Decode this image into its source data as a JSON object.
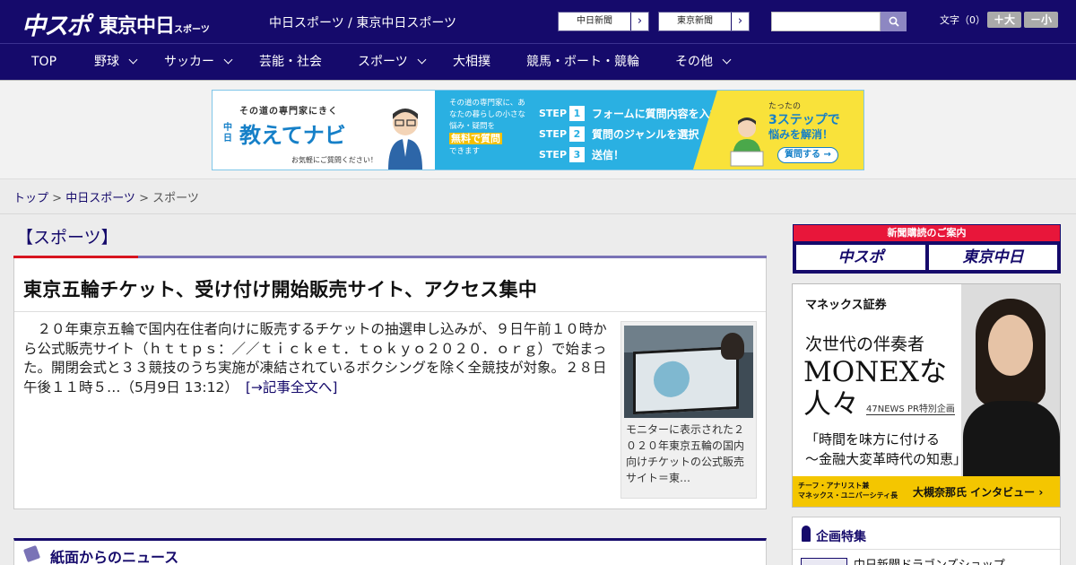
{
  "header": {
    "logo_chusupo": "中スポ",
    "logo_tokyo": "東京中日",
    "logo_tokyo_small": "スポーツ",
    "site_title": "中日スポーツ / 東京中日スポーツ",
    "paper_links": [
      "中日新聞",
      "東京新聞"
    ],
    "fontsize_label": "文字（0）",
    "fontsize_up": "＋大",
    "fontsize_down": "－小"
  },
  "nav": [
    {
      "label": "TOP"
    },
    {
      "label": "野球"
    },
    {
      "label": "サッカー"
    },
    {
      "label": "芸能・社会"
    },
    {
      "label": "スポーツ"
    },
    {
      "label": "大相撲"
    },
    {
      "label": "競馬・ボート・競輪"
    },
    {
      "label": "その他"
    }
  ],
  "banner": {
    "sub": "その道の専門家にきく",
    "chu": "中日",
    "main": "教えてナビ",
    "note": "お気軽にご質問ください！",
    "mid_text": "その道の専門家に、あなたの暮らしの小さな悩み・疑問を",
    "mid_highlight": "無料で質問",
    "mid_end": "できます",
    "steps": [
      {
        "label": "STEP",
        "num": "1",
        "text": "フォームに質問内容を入力"
      },
      {
        "label": "STEP",
        "num": "2",
        "text": "質問のジャンルを選択"
      },
      {
        "label": "STEP",
        "num": "3",
        "text": "送信！"
      }
    ],
    "r1": "たったの",
    "r2": "3ステップで",
    "r3": "悩みを解消！",
    "r4": "質問する →"
  },
  "breadcrumb": {
    "home": "トップ",
    "sep1": " > ",
    "section": "中日スポーツ",
    "sep2": " > ",
    "current": "スポーツ"
  },
  "section_heading": "【スポーツ】",
  "article": {
    "title": "東京五輪チケット、受け付け開始販売サイト、アクセス集中",
    "body": "　２０年東京五輪で国内在住者向けに販売するチケットの抽選申し込みが、９日午前１０時から公式販売サイト（ｈｔｔｐｓ：／／ｔｉｃｋｅｔ．ｔｏｋｙｏ２０２０．ｏｒｇ）で始まった。開閉会式と３３競技のうち実施が凍結されているボクシングを除く全競技が対象。２８日午後１１時５…（5月9日 13:12）",
    "more": "[→記事全文へ]",
    "caption": "モニターに表示された２０２０年東京五輪の国内向けチケットの公式販売サイト＝東…"
  },
  "news_section": "紙面からのニュース",
  "sidebar": {
    "subscribe_head": "新聞購読のご案内",
    "sub_logo1": "中スポ",
    "sub_logo2": "東京中日",
    "ad": {
      "brand": "マネックス証券",
      "line1": "次世代の伴奏者",
      "line2": "MONEXな人々",
      "tag": "47NEWS PR特別企画",
      "quote1": "「時間を味方に付ける",
      "quote2": "〜金融大変革時代の知恵」",
      "foot1": "チーフ・アナリスト兼",
      "foot2": "マネックス・ユニバーシティ長",
      "foot_name": "大槻奈那氏 インタビュー ›"
    },
    "feature_title": "企画特集",
    "feature_item": "中日新聞ドラゴンズショップ"
  },
  "colors": {
    "brand_navy": "#150a6b",
    "accent_red": "#d7141f",
    "accent_purple": "#7a73b6"
  }
}
